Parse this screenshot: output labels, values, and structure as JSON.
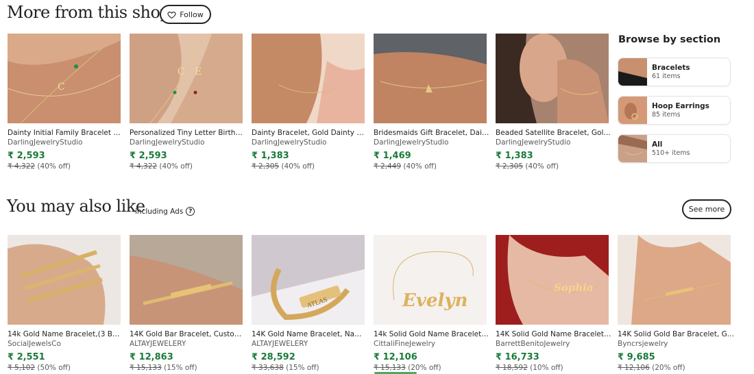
{
  "shop_section": {
    "title": "More from this shop",
    "follow_label": "Follow",
    "products": [
      {
        "title": "Dainty Initial Family Bracelet wi...",
        "shop": "DarlingJewelryStudio",
        "price": "₹ 2,593",
        "original": "₹ 4,322",
        "discount": "(40% off)"
      },
      {
        "title": "Personalized Tiny Letter Birthst...",
        "shop": "DarlingJewelryStudio",
        "price": "₹ 2,593",
        "original": "₹ 4,322",
        "discount": "(40% off)"
      },
      {
        "title": "Dainty Bracelet, Gold Dainty Br...",
        "shop": "DarlingJewelryStudio",
        "price": "₹ 1,383",
        "original": "₹ 2,305",
        "discount": "(40% off)"
      },
      {
        "title": "Bridesmaids Gift Bracelet, Dain...",
        "shop": "DarlingJewelryStudio",
        "price": "₹ 1,469",
        "original": "₹ 2,449",
        "discount": "(40% off)"
      },
      {
        "title": "Beaded Satellite Bracelet, Gold...",
        "shop": "DarlingJewelryStudio",
        "price": "₹ 1,383",
        "original": "₹ 2,305",
        "discount": "(40% off)"
      }
    ]
  },
  "browse": {
    "title": "Browse by section",
    "sections": [
      {
        "name": "Bracelets",
        "count": "61 items"
      },
      {
        "name": "Hoop Earrings",
        "count": "85 items"
      },
      {
        "name": "All",
        "count": "510+ items"
      }
    ]
  },
  "also_like": {
    "title": "You may also like",
    "subtitle": "including Ads",
    "help_icon": "?",
    "see_more_label": "See more",
    "products": [
      {
        "title": "14k Gold Name Bracelet,(3 BRA...",
        "shop": "SocialJewelsCo",
        "price": "₹ 2,551",
        "original": "₹ 5,102",
        "discount": "(50% off)"
      },
      {
        "title": "14K Gold Bar Bracelet, Custom ...",
        "shop": "ALTAYJEWELERY",
        "price": "₹ 12,863",
        "original": "₹ 15,133",
        "discount": "(15% off)"
      },
      {
        "title": "14K Gold Name Bracelet, Name...",
        "shop": "ALTAYJEWELERY",
        "price": "₹ 28,592",
        "original": "₹ 33,638",
        "discount": "(15% off)"
      },
      {
        "title": "14k Solid Gold Name Bracelet /...",
        "shop": "CittaliFineJewelry",
        "price": "₹ 12,106",
        "original": "₹ 15,133",
        "discount": "(20% off)"
      },
      {
        "title": "14K Solid Gold Name Bracelet, ...",
        "shop": "BarrettBenitoJewelry",
        "price": "₹ 16,733",
        "original": "₹ 18,592",
        "discount": "(10% off)"
      },
      {
        "title": "14K Solid Gold Bar Bracelet, G...",
        "shop": "Byncrsjewelry",
        "price": "₹ 9,685",
        "original": "₹ 12,106",
        "discount": "(20% off)"
      }
    ],
    "image_texts": [
      "ATLAS",
      "Evelyn",
      "Sophia"
    ]
  },
  "colors": {
    "price_green": "#1a7a3a",
    "text": "#222222",
    "muted": "#595959"
  }
}
